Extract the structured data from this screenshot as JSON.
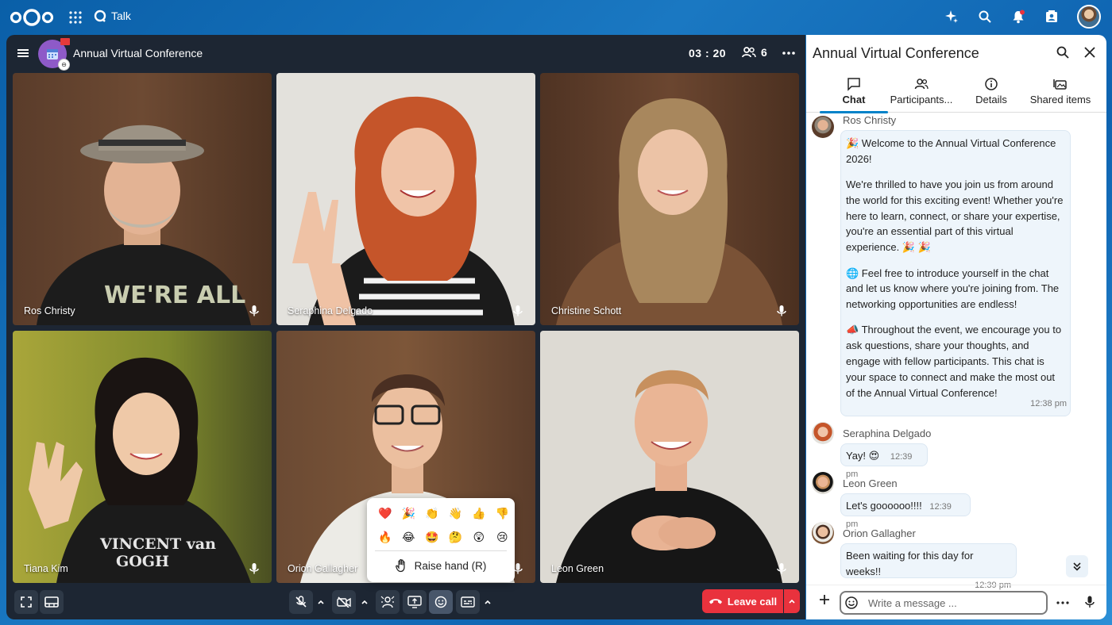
{
  "topbar": {
    "app_name": "Talk",
    "icons": [
      "nextcloud-logo",
      "apps-grid-icon",
      "talk-icon",
      "assistant-sparkle-icon",
      "search-icon",
      "notifications-bell-icon",
      "contacts-icon",
      "user-avatar"
    ]
  },
  "call": {
    "title": "Annual Virtual Conference",
    "timer": "03 : 20",
    "participant_count": "6",
    "tiles": [
      {
        "name": "Ros Christy"
      },
      {
        "name": "Seraphina Delgado"
      },
      {
        "name": "Christine Schott"
      },
      {
        "name": "Tiana Kim"
      },
      {
        "name": "Orion Gallagher"
      },
      {
        "name": "Leon Green"
      }
    ],
    "leave_label": "Leave call",
    "reactions": {
      "row1": [
        "❤️",
        "🎉",
        "👏",
        "👋",
        "👍",
        "👎"
      ],
      "row2": [
        "🔥",
        "😂",
        "🤩",
        "🤔",
        "😲",
        "😢"
      ],
      "raise_hand_label": "Raise hand (R)"
    }
  },
  "sidebar": {
    "title": "Annual Virtual Conference",
    "tabs": [
      {
        "label": "Chat",
        "active": true
      },
      {
        "label": "Participants..."
      },
      {
        "label": "Details"
      },
      {
        "label": "Shared items"
      }
    ],
    "messages": [
      {
        "author": "Ros Christy",
        "paragraphs": [
          "🎉 Welcome to the Annual Virtual Conference 2026!",
          "We're thrilled to have you join us from around the world for this exciting event! Whether you're here to learn, connect, or share your expertise, you're an essential part of this virtual experience. 🎉 🎉",
          "🌐 Feel free to introduce yourself in the chat and let us know where you're joining from. The networking opportunities are endless!",
          "📣 Throughout the event, we encourage you to ask questions, share your thoughts, and engage with fellow participants. This chat is your space to connect and make the most out of the Annual Virtual Conference!"
        ],
        "time": "12:38 pm"
      },
      {
        "author": "Seraphina Delgado",
        "text": "Yay! 😍",
        "time": "12:39 pm"
      },
      {
        "author": "Leon Green",
        "text": "Let's goooooo!!!!",
        "time": "12:39 pm"
      },
      {
        "author": "Orion Gallagher",
        "text": "Been waiting for this day for weeks!!",
        "time": "12:39 pm"
      }
    ],
    "composer_placeholder": "Write a message ..."
  }
}
